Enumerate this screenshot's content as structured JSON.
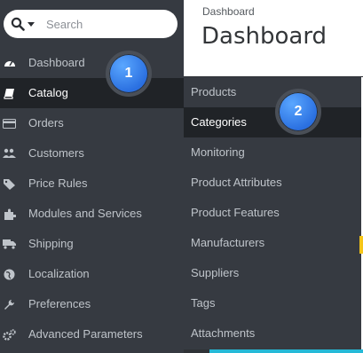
{
  "header": {
    "breadcrumb": "Dashboard",
    "title": "Dashboard"
  },
  "search": {
    "placeholder": "Search"
  },
  "sidebar": {
    "items": [
      {
        "label": "Dashboard",
        "icon": "dashboard-icon"
      },
      {
        "label": "Catalog",
        "icon": "book-icon"
      },
      {
        "label": "Orders",
        "icon": "credit-card-icon"
      },
      {
        "label": "Customers",
        "icon": "users-icon"
      },
      {
        "label": "Price Rules",
        "icon": "tags-icon"
      },
      {
        "label": "Modules and Services",
        "icon": "puzzle-icon"
      },
      {
        "label": "Shipping",
        "icon": "truck-icon"
      },
      {
        "label": "Localization",
        "icon": "globe-icon"
      },
      {
        "label": "Preferences",
        "icon": "wrench-icon"
      },
      {
        "label": "Advanced Parameters",
        "icon": "cogs-icon"
      }
    ]
  },
  "submenu": {
    "items": [
      {
        "label": "Products"
      },
      {
        "label": "Categories"
      },
      {
        "label": "Monitoring"
      },
      {
        "label": "Product Attributes"
      },
      {
        "label": "Product Features"
      },
      {
        "label": "Manufacturers"
      },
      {
        "label": "Suppliers"
      },
      {
        "label": "Tags"
      },
      {
        "label": "Attachments"
      }
    ]
  },
  "badges": {
    "one": "1",
    "two": "2"
  },
  "colors": {
    "sidebar_bg": "#363a41",
    "active_bg": "#202327",
    "text": "#bfc4ca",
    "badge_blue": "#2a6fe0",
    "accent_cyan": "#25b9d7"
  }
}
